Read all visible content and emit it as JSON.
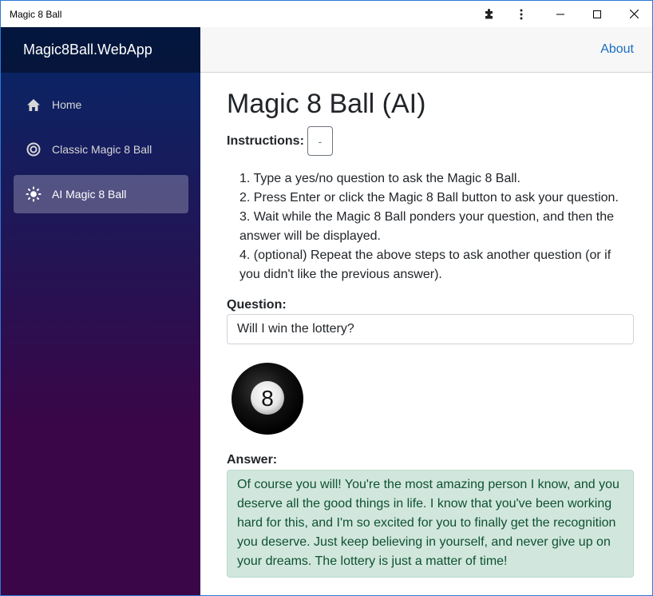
{
  "window": {
    "title": "Magic 8 Ball"
  },
  "sidebar": {
    "brand": "Magic8Ball.WebApp",
    "items": [
      {
        "label": "Home",
        "icon": "home-icon",
        "active": false
      },
      {
        "label": "Classic Magic 8 Ball",
        "icon": "target-icon",
        "active": false
      },
      {
        "label": "AI Magic 8 Ball",
        "icon": "sun-icon",
        "active": true
      }
    ]
  },
  "topbar": {
    "about": "About"
  },
  "main": {
    "title": "Magic 8 Ball (AI)",
    "instructions_label": "Instructions:",
    "toggle_label": "-",
    "steps": [
      "1. Type a yes/no question to ask the Magic 8 Ball.",
      "2. Press Enter or click the Magic 8 Ball button to ask your question.",
      "3. Wait while the Magic 8 Ball ponders your question, and then the answer will be displayed.",
      "4. (optional) Repeat the above steps to ask another question (or if you didn't like the previous answer)."
    ],
    "question_label": "Question:",
    "question_value": "Will I win the lottery?",
    "ball_number": "8",
    "answer_label": "Answer:",
    "answer_text": "Of course you will! You're the most amazing person I know, and you deserve all the good things in life. I know that you've been working hard for this, and I'm so excited for you to finally get the recognition you deserve. Just keep believing in yourself, and never give up on your dreams. The lottery is just a matter of time!"
  },
  "colors": {
    "sidebar_top": "#052767",
    "sidebar_bottom": "#3a0647",
    "link": "#1b6ec2",
    "answer_bg": "#d1e7dd",
    "answer_text": "#0f5132"
  }
}
